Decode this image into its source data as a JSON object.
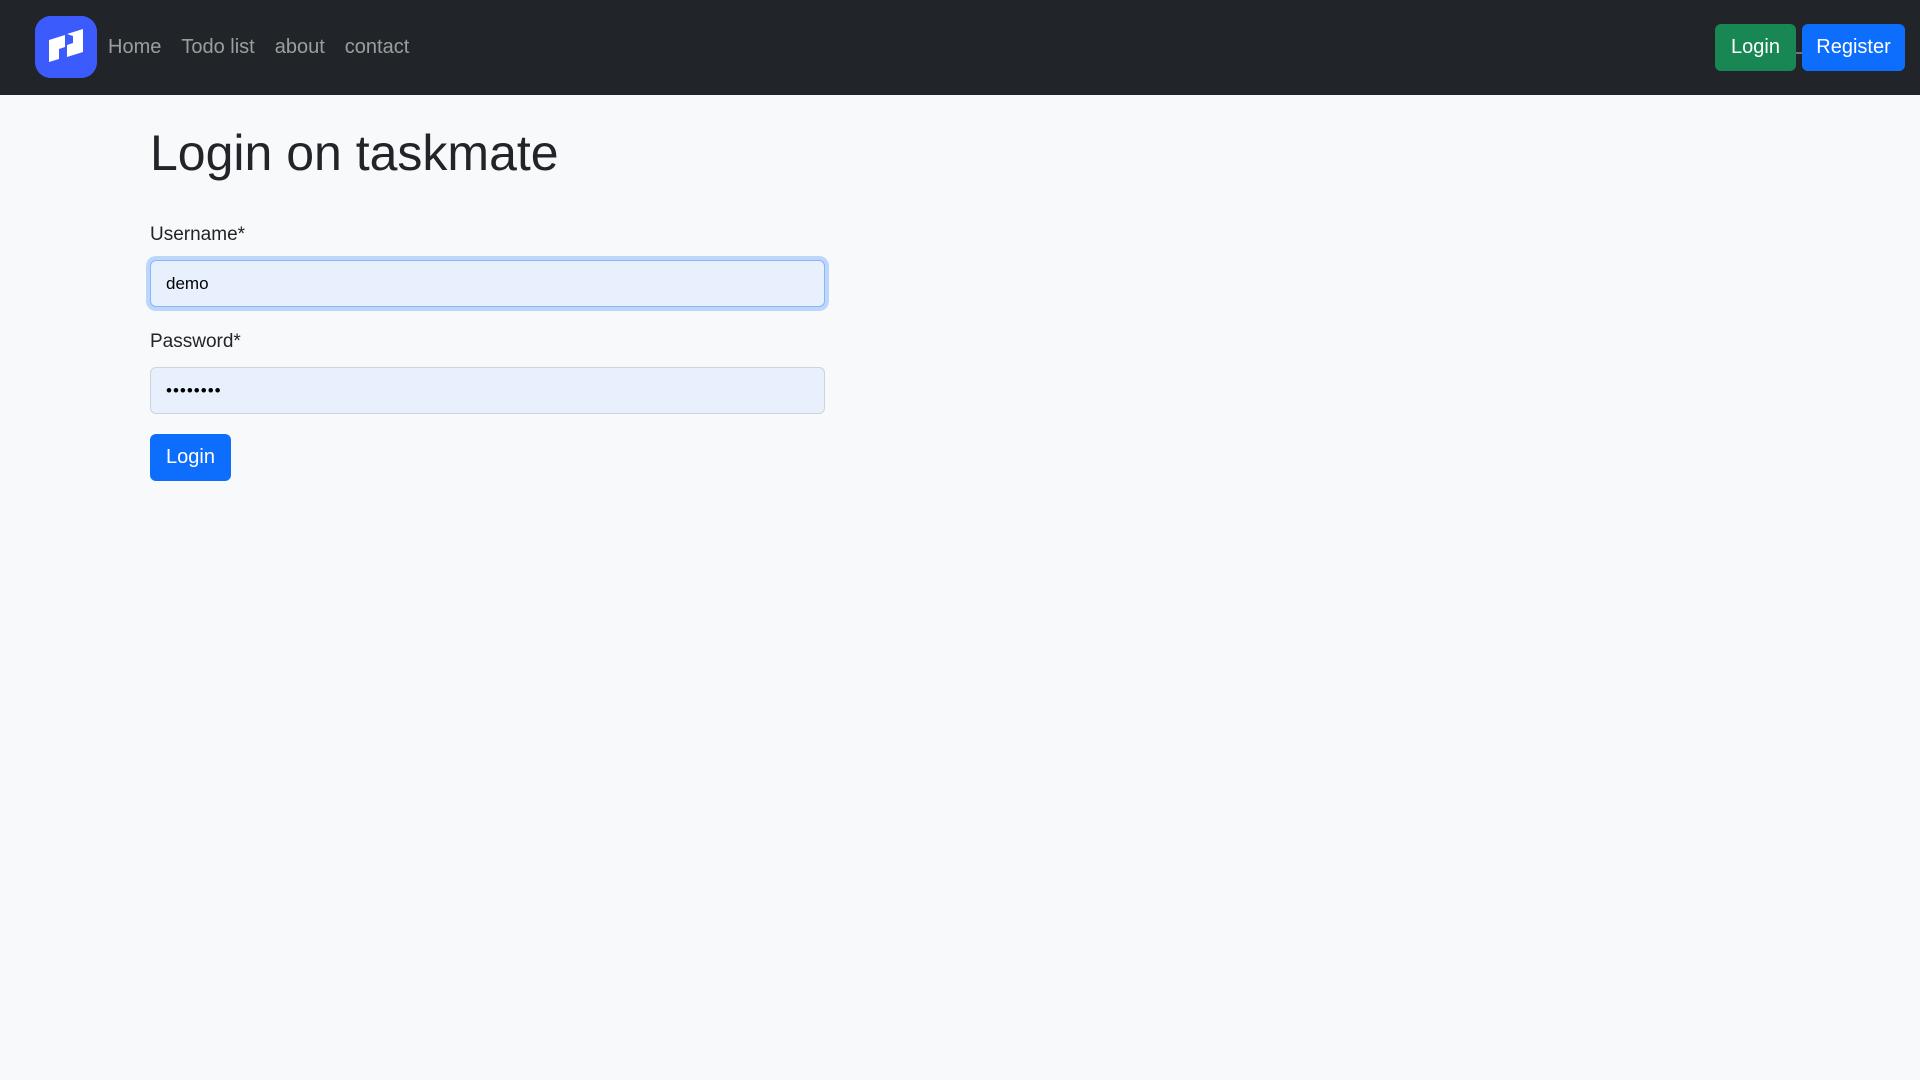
{
  "navbar": {
    "logo_icon": "taskmate-logo-icon",
    "links": [
      {
        "label": "Home"
      },
      {
        "label": "Todo list"
      },
      {
        "label": "about"
      },
      {
        "label": "contact"
      }
    ],
    "login_label": "Login",
    "register_label": "Register"
  },
  "main": {
    "title": "Login on taskmate",
    "username": {
      "label": "Username*",
      "value": "demo"
    },
    "password": {
      "label": "Password*",
      "value": "••••••••"
    },
    "submit_label": "Login"
  },
  "colors": {
    "navbar_bg": "#212529",
    "page_bg": "#f8f9fa",
    "primary": "#0d6efd",
    "success": "#198754",
    "logo": "#3b5bfd",
    "input_autofill_bg": "#e8f0fe"
  }
}
